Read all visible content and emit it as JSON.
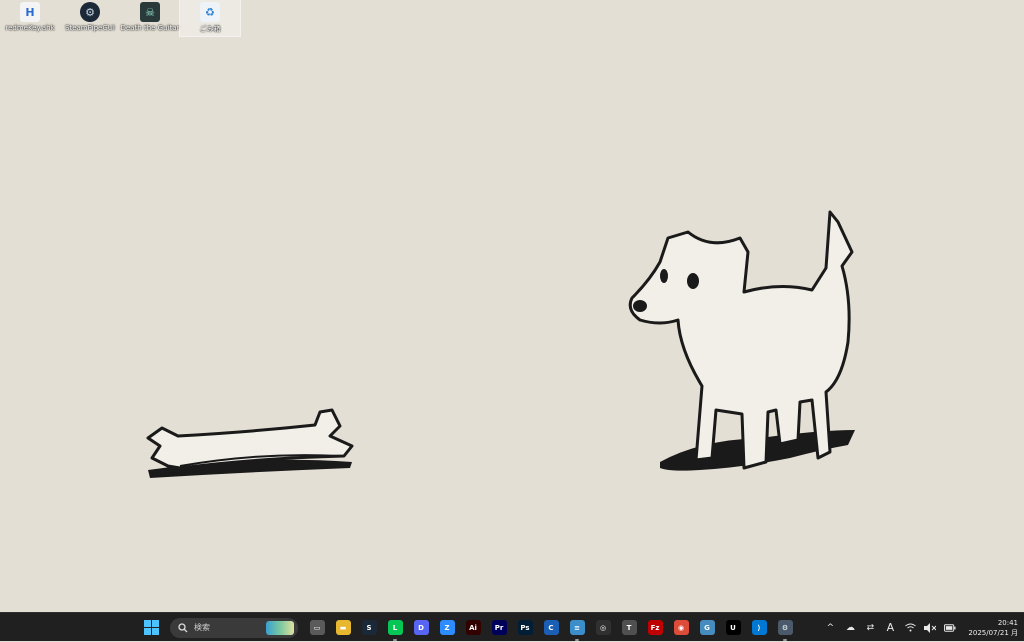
{
  "desktop_icons": [
    {
      "label": "redmeKey.ahk",
      "icon": "ahk-file-icon",
      "glyph": "H"
    },
    {
      "label": "SteamPipeGUI",
      "icon": "steam-icon",
      "glyph": "⚙"
    },
    {
      "label": "Death the Guitar",
      "icon": "game-icon",
      "glyph": "☠"
    },
    {
      "label": "ごみ箱",
      "icon": "recycle-bin-icon",
      "glyph": "♻"
    }
  ],
  "taskbar": {
    "search_label": "検索",
    "apps": [
      {
        "name": "task-view-icon",
        "glyph": "▭",
        "color": "#5a5a5a",
        "running": false
      },
      {
        "name": "file-explorer-icon",
        "glyph": "▬",
        "color": "#e8b730",
        "running": false
      },
      {
        "name": "steam-icon",
        "glyph": "S",
        "color": "#1b2838",
        "running": false
      },
      {
        "name": "line-icon",
        "glyph": "L",
        "color": "#06c755",
        "running": true
      },
      {
        "name": "discord-icon",
        "glyph": "D",
        "color": "#5865f2",
        "running": false
      },
      {
        "name": "zoom-icon",
        "glyph": "Z",
        "color": "#2d8cff",
        "running": false
      },
      {
        "name": "illustrator-icon",
        "glyph": "Ai",
        "color": "#330000",
        "running": false
      },
      {
        "name": "premiere-icon",
        "glyph": "Pr",
        "color": "#00005b",
        "running": false
      },
      {
        "name": "photoshop-icon",
        "glyph": "Ps",
        "color": "#001e36",
        "running": false
      },
      {
        "name": "clip-studio-icon",
        "glyph": "C",
        "color": "#1a5fb4",
        "running": false
      },
      {
        "name": "notepad-icon",
        "glyph": "≡",
        "color": "#3b8ec9",
        "running": true
      },
      {
        "name": "obs-icon",
        "glyph": "◎",
        "color": "#303030",
        "running": false
      },
      {
        "name": "twitch-icon",
        "glyph": "T",
        "color": "#505050",
        "running": false
      },
      {
        "name": "filezilla-icon",
        "glyph": "Fz",
        "color": "#bf0000",
        "running": false
      },
      {
        "name": "chrome-icon",
        "glyph": "◉",
        "color": "#dd4b39",
        "running": false
      },
      {
        "name": "godot-icon",
        "glyph": "G",
        "color": "#478cbf",
        "running": false
      },
      {
        "name": "unity-icon",
        "glyph": "U",
        "color": "#000000",
        "running": false
      },
      {
        "name": "vscode-icon",
        "glyph": "⟩",
        "color": "#0078d4",
        "running": false
      },
      {
        "name": "settings-icon",
        "glyph": "⚙",
        "color": "#4a5a6a",
        "running": true
      }
    ]
  },
  "tray": {
    "chevron": "^",
    "ime": "A",
    "time": "20:41",
    "date": "2025/07/21 月"
  }
}
